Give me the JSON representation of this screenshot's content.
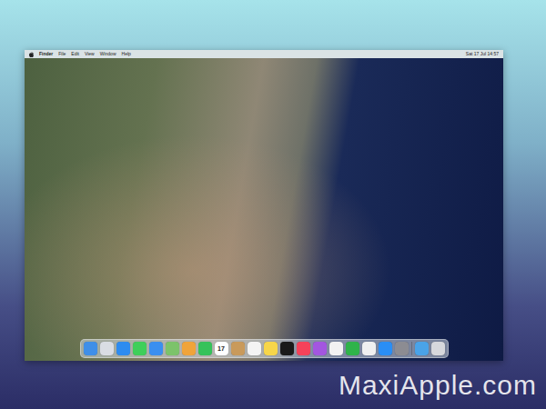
{
  "menubar": {
    "app": "Finder",
    "items": [
      "File",
      "Edit",
      "View",
      "Window",
      "Help"
    ],
    "clock": "Sat 17 Jul 14:57"
  },
  "dock": {
    "apps": [
      {
        "name": "finder",
        "color": "#3f8fe8"
      },
      {
        "name": "launchpad",
        "color": "#d9dde4"
      },
      {
        "name": "safari",
        "color": "#2d8cf0"
      },
      {
        "name": "messages",
        "color": "#3fcf5a"
      },
      {
        "name": "mail",
        "color": "#3a8ff0"
      },
      {
        "name": "maps",
        "color": "#7cc36a"
      },
      {
        "name": "photos",
        "color": "#f0a43a"
      },
      {
        "name": "facetime",
        "color": "#36c25a"
      },
      {
        "name": "calendar",
        "color": "#ffffff",
        "text": "17"
      },
      {
        "name": "contacts",
        "color": "#c99a5b"
      },
      {
        "name": "reminders",
        "color": "#f4f4f4"
      },
      {
        "name": "notes",
        "color": "#f7d64a"
      },
      {
        "name": "tv",
        "color": "#1a1a1a"
      },
      {
        "name": "music",
        "color": "#f5425a"
      },
      {
        "name": "podcasts",
        "color": "#a356e0"
      },
      {
        "name": "news",
        "color": "#f2f2f2"
      },
      {
        "name": "numbers",
        "color": "#2fb34a"
      },
      {
        "name": "pages",
        "color": "#f0f0f0"
      },
      {
        "name": "app-store",
        "color": "#2a8ef5"
      },
      {
        "name": "system-preferences",
        "color": "#8c8c92"
      }
    ],
    "stacks": [
      {
        "name": "downloads",
        "color": "#4aa3e8"
      },
      {
        "name": "trash",
        "color": "#d6d8dc"
      }
    ]
  },
  "watermark": "MaxiApple.com"
}
